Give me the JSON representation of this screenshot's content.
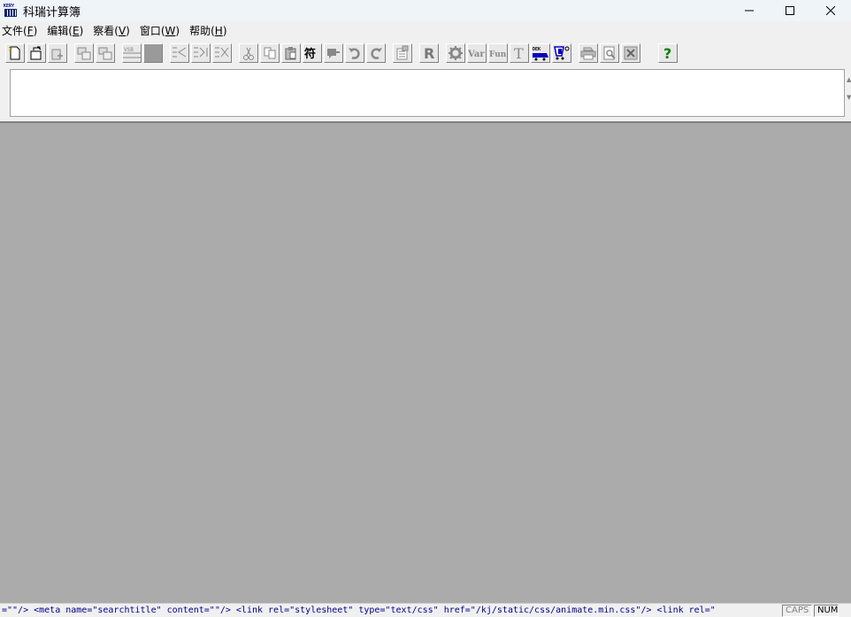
{
  "window": {
    "title": "科瑞计算簿",
    "icon_text": "KERY"
  },
  "menu": [
    {
      "label": "文件(",
      "mnemonic": "F",
      "suffix": ")"
    },
    {
      "label": "编辑(",
      "mnemonic": "E",
      "suffix": ")"
    },
    {
      "label": "察看(",
      "mnemonic": "V",
      "suffix": ")"
    },
    {
      "label": "窗口(",
      "mnemonic": "W",
      "suffix": ")"
    },
    {
      "label": "帮助(",
      "mnemonic": "H",
      "suffix": ")"
    }
  ],
  "toolbar": {
    "vsb_label": "VSB",
    "r_label": "R",
    "var_label": "Var",
    "fun_label": "Fun",
    "t_label": "T",
    "dek_label": "DEK",
    "help_label": "?"
  },
  "formula_input": {
    "value": ""
  },
  "status": {
    "message": "=\"\"/>    <meta name=\"searchtitle\" content=\"\"/>    <link rel=\"stylesheet\" type=\"text/css\" href=\"/kj/static/css/animate.min.css\"/>    <link rel=\"",
    "caps": "CAPS",
    "num": "NUM"
  },
  "colors": {
    "mdi_background": "#ababab",
    "status_text": "#00008b",
    "accent_blue": "#0000c0"
  }
}
